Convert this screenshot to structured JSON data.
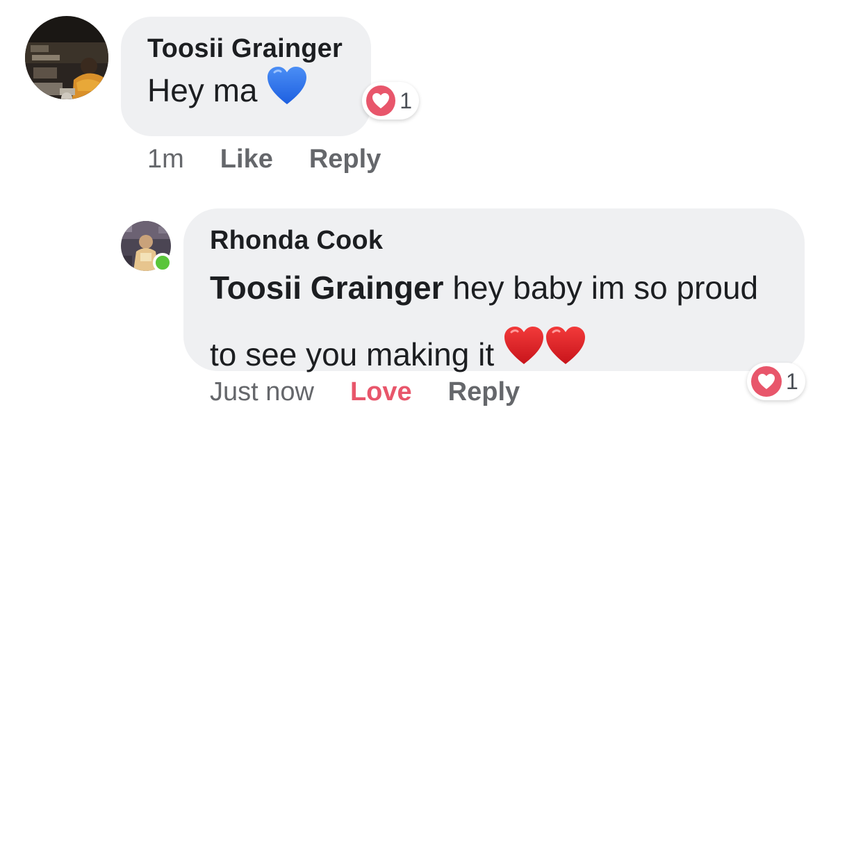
{
  "comments": [
    {
      "author": "Toosii Grainger",
      "text": "Hey ma",
      "emoji": "blue-heart",
      "time": "1m",
      "actions": {
        "react": "Like",
        "reply": "Reply"
      },
      "reaction": {
        "type": "love",
        "count": "1"
      }
    },
    {
      "author": "Rhonda Cook",
      "mention": "Toosii Grainger",
      "text": " hey baby im so proud to see you making it ",
      "emoji": "red-heart x2",
      "time": "Just now",
      "actions": {
        "react": "Love",
        "reply": "Reply"
      },
      "reaction": {
        "type": "love",
        "count": "1"
      },
      "online": true
    }
  ],
  "colors": {
    "bubble": "#eff0f2",
    "love": "#e8566b",
    "meta": "#65676b",
    "online": "#5ac53a"
  }
}
